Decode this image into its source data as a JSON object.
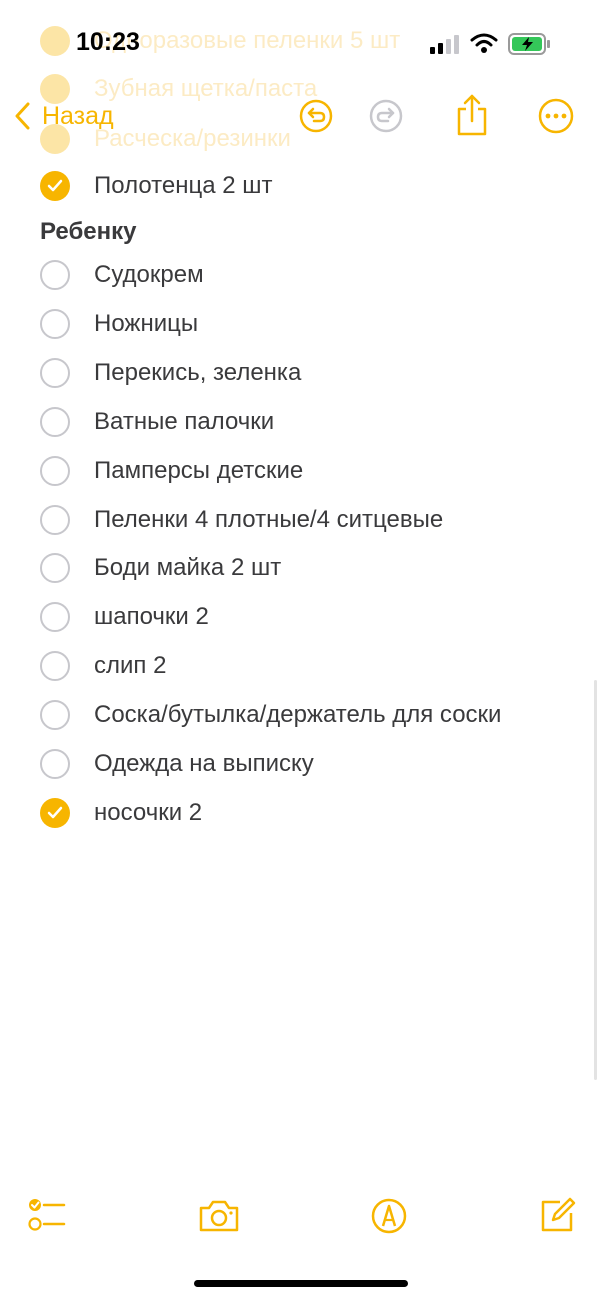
{
  "status_bar": {
    "time": "10:23"
  },
  "nav": {
    "back_label": "Назад",
    "undo_icon": "undo-icon",
    "redo_icon": "redo-icon",
    "share_icon": "share-icon",
    "more_icon": "more-icon",
    "accent": "#f7b500"
  },
  "note": {
    "scrolled_items": [
      {
        "text": "Одноразовые пеленки 5 шт",
        "checked": true
      },
      {
        "text": "Зубная щетка/паста",
        "checked": true
      },
      {
        "text": "Расческа/резинки",
        "checked": true
      }
    ],
    "top_items": [
      {
        "text": "Полотенца 2 шт",
        "checked": true
      }
    ],
    "section_heading": "Ребенку",
    "section_items": [
      {
        "text": "Судокрем",
        "checked": false
      },
      {
        "text": "Ножницы",
        "checked": false
      },
      {
        "text": "Перекись, зеленка",
        "checked": false
      },
      {
        "text": "Ватные палочки",
        "checked": false
      },
      {
        "text": "Памперсы детские",
        "checked": false
      },
      {
        "text": "Пеленки 4 плотные/4 ситцевые",
        "checked": false
      },
      {
        "text": "Боди майка 2 шт",
        "checked": false
      },
      {
        "text": "шапочки 2",
        "checked": false
      },
      {
        "text": "слип 2",
        "checked": false
      },
      {
        "text": "Соска/бутылка/держатель для соски",
        "checked": false
      },
      {
        "text": "Одежда на выписку",
        "checked": false
      },
      {
        "text": "носочки 2",
        "checked": true
      }
    ]
  },
  "toolbar": {
    "checklist_icon": "checklist-icon",
    "camera_icon": "camera-icon",
    "markup_icon": "markup-pen-icon",
    "compose_icon": "compose-icon"
  }
}
